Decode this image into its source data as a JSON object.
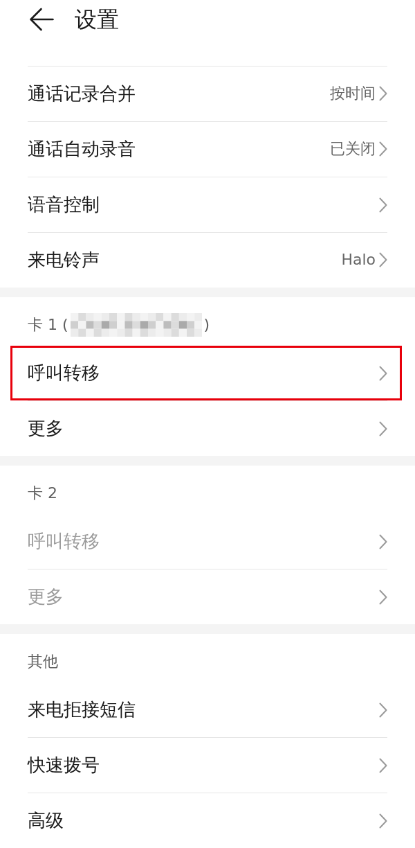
{
  "header": {
    "title": "设置"
  },
  "sections": [
    {
      "items": [
        {
          "label": "通话记录合并",
          "value": "按时间",
          "disabled": false,
          "highlighted": false
        },
        {
          "label": "通话自动录音",
          "value": "已关闭",
          "disabled": false,
          "highlighted": false
        },
        {
          "label": "语音控制",
          "disabled": false,
          "highlighted": false
        },
        {
          "label": "来电铃声",
          "value": "Halo",
          "disabled": false,
          "highlighted": false
        }
      ]
    },
    {
      "header": {
        "text": "卡 1 (",
        "redacted": true,
        "suffix": ")"
      },
      "items": [
        {
          "label": "呼叫转移",
          "disabled": false,
          "highlighted": true
        },
        {
          "label": "更多",
          "disabled": false,
          "highlighted": false
        }
      ]
    },
    {
      "header": {
        "text": "卡 2"
      },
      "items": [
        {
          "label": "呼叫转移",
          "disabled": true,
          "highlighted": false
        },
        {
          "label": "更多",
          "disabled": true,
          "highlighted": false
        }
      ]
    },
    {
      "header": {
        "text": "其他"
      },
      "items": [
        {
          "label": "来电拒接短信",
          "disabled": false,
          "highlighted": false
        },
        {
          "label": "快速拨号",
          "disabled": false,
          "highlighted": false
        },
        {
          "label": "高级",
          "disabled": false,
          "highlighted": false
        }
      ]
    }
  ]
}
